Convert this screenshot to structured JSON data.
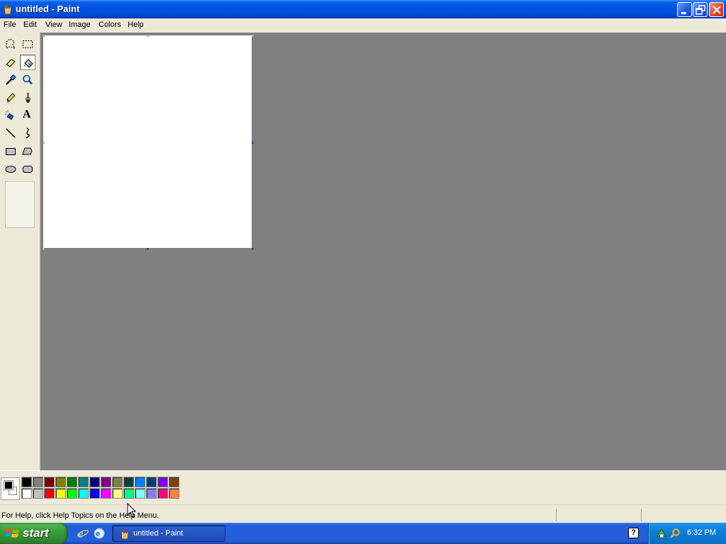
{
  "window": {
    "title": "untitled - Paint",
    "icon": "paint-brush-cup-icon",
    "controls": [
      "minimize-icon",
      "restore-icon",
      "close-icon"
    ]
  },
  "menu": [
    "File",
    "Edit",
    "View",
    "Image",
    "Colors",
    "Help"
  ],
  "tools": [
    {
      "name": "free-form-select-icon"
    },
    {
      "name": "rectangle-select-icon"
    },
    {
      "name": "eraser-icon"
    },
    {
      "name": "fill-with-color-icon",
      "selected": true
    },
    {
      "name": "pick-color-icon"
    },
    {
      "name": "magnifier-icon"
    },
    {
      "name": "pencil-icon"
    },
    {
      "name": "brush-icon"
    },
    {
      "name": "airbrush-icon"
    },
    {
      "name": "text-icon",
      "glyph": "A"
    },
    {
      "name": "line-icon"
    },
    {
      "name": "curve-icon"
    },
    {
      "name": "rectangle-icon"
    },
    {
      "name": "polygon-icon"
    },
    {
      "name": "ellipse-icon"
    },
    {
      "name": "rounded-rectangle-icon"
    }
  ],
  "palette": {
    "foreground": "#000000",
    "background": "#ffffff",
    "row1": [
      "#000000",
      "#808080",
      "#800000",
      "#808000",
      "#008000",
      "#008080",
      "#000080",
      "#800080",
      "#808040",
      "#004040",
      "#0080ff",
      "#004080",
      "#8000ff",
      "#804000"
    ],
    "row2": [
      "#ffffff",
      "#c0c0c0",
      "#ff0000",
      "#ffff00",
      "#00ff00",
      "#00ffff",
      "#0000ff",
      "#ff00ff",
      "#ffff80",
      "#00ff80",
      "#80ffff",
      "#8080ff",
      "#ff0080",
      "#ff8040"
    ]
  },
  "status": {
    "text": "For Help, click Help Topics on the Help Menu."
  },
  "taskbar": {
    "start_label": "start",
    "quick_launch": [
      "internet-explorer-icon",
      "show-desktop-icon"
    ],
    "task_button_label": "untitled - Paint",
    "help_glyph": "?",
    "tray_icons": [
      "network-icon",
      "search-icon"
    ],
    "clock": "6:32 PM"
  }
}
